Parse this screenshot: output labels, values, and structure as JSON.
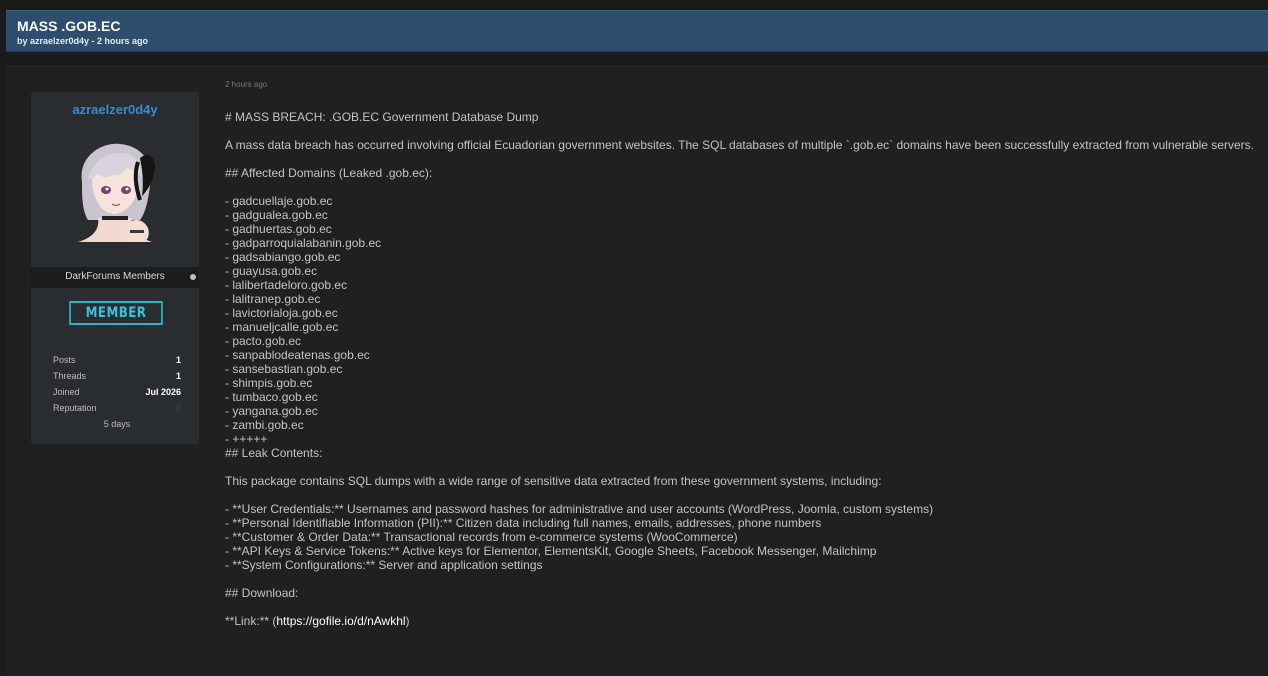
{
  "thread": {
    "title": "MASS .GOB.EC",
    "meta": "by azraelzer0d4y - 2 hours ago"
  },
  "author": {
    "name": "azraelzer0d4y",
    "avatar_icon": "anime-avatar",
    "usergroup": "DarkForums Members",
    "rank": "MEMBER",
    "stats": {
      "posts_label": "Posts",
      "posts": "1",
      "threads_label": "Threads",
      "threads": "1",
      "joined_label": "Joined",
      "joined": "Jul 2026",
      "reputation_label": "Reputation",
      "reputation": "0",
      "extra": "5 days"
    }
  },
  "post": {
    "date": "2 hours ago",
    "heading": "# MASS BREACH: .GOB.EC Government Database Dump",
    "intro": "A mass data breach has occurred involving official Ecuadorian government websites. The SQL databases of multiple `.gob.ec` domains have been successfully extracted from vulnerable servers.",
    "domains_heading": "## Affected Domains (Leaked .gob.ec):",
    "domains": [
      "- gadcuellaje.gob.ec",
      "- gadgualea.gob.ec",
      "- gadhuertas.gob.ec",
      "- gadparroquialabanin.gob.ec",
      "- gadsabiango.gob.ec",
      "- guayusa.gob.ec",
      "- lalibertadeloro.gob.ec",
      "- lalitranep.gob.ec",
      "- lavictorialoja.gob.ec",
      "- manueljcalle.gob.ec",
      "- pacto.gob.ec",
      "- sanpablodeatenas.gob.ec",
      "- sansebastian.gob.ec",
      "- shimpis.gob.ec",
      "- tumbaco.gob.ec",
      "- yangana.gob.ec",
      "- zambi.gob.ec",
      "- +++++"
    ],
    "contents_heading": "## Leak Contents:",
    "contents_intro": "This package contains SQL dumps with a wide range of sensitive data extracted from these government systems, including:",
    "contents": [
      "- **User Credentials:** Usernames and password hashes for administrative and user accounts (WordPress, Joomla, custom systems)",
      "- **Personal Identifiable Information (PII):** Citizen data including full names, emails, addresses, phone numbers",
      "- **Customer & Order Data:** Transactional records from e-commerce systems (WooCommerce)",
      "- **API Keys & Service Tokens:** Active keys for Elementor, ElementsKit, Google Sheets, Facebook Messenger, Mailchimp",
      "- **System Configurations:** Server and application settings"
    ],
    "download_heading": "## Download:",
    "link_prefix": "**Link:** (",
    "link_text": "https://gofile.io/d/nAwkhl",
    "link_suffix": ")"
  }
}
